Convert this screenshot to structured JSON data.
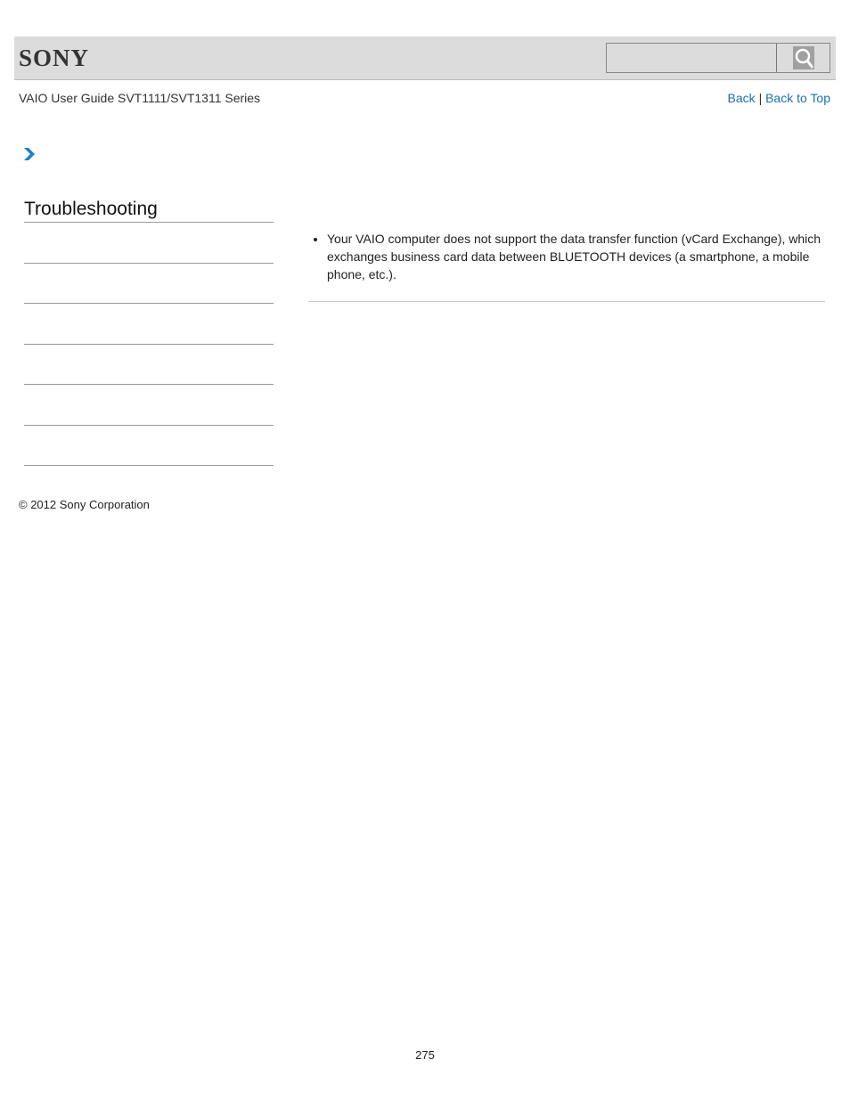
{
  "header": {
    "logo": "SONY",
    "search": {
      "value": "",
      "placeholder": ""
    },
    "search_icon": "magnifier-icon"
  },
  "subheader": {
    "guide_title": "VAIO User Guide SVT1111/SVT1311 Series",
    "back_label": "Back",
    "separator": "|",
    "back_to_top_label": "Back to Top"
  },
  "breadcrumb": {
    "icon": "chevron-right-icon",
    "color": "#1a7fc8"
  },
  "sidebar": {
    "title": "Troubleshooting",
    "items": [
      "",
      "",
      "",
      "",
      "",
      ""
    ]
  },
  "content": {
    "bullets": [
      "Your VAIO computer does not support the data transfer function (vCard Exchange), which exchanges business card data between BLUETOOTH devices (a smartphone, a mobile phone, etc.)."
    ]
  },
  "footer": {
    "copyright": "© 2012 Sony Corporation",
    "page_number": "275"
  },
  "colors": {
    "header_bg": "#dcdcdc",
    "link": "#1a6fb5"
  }
}
